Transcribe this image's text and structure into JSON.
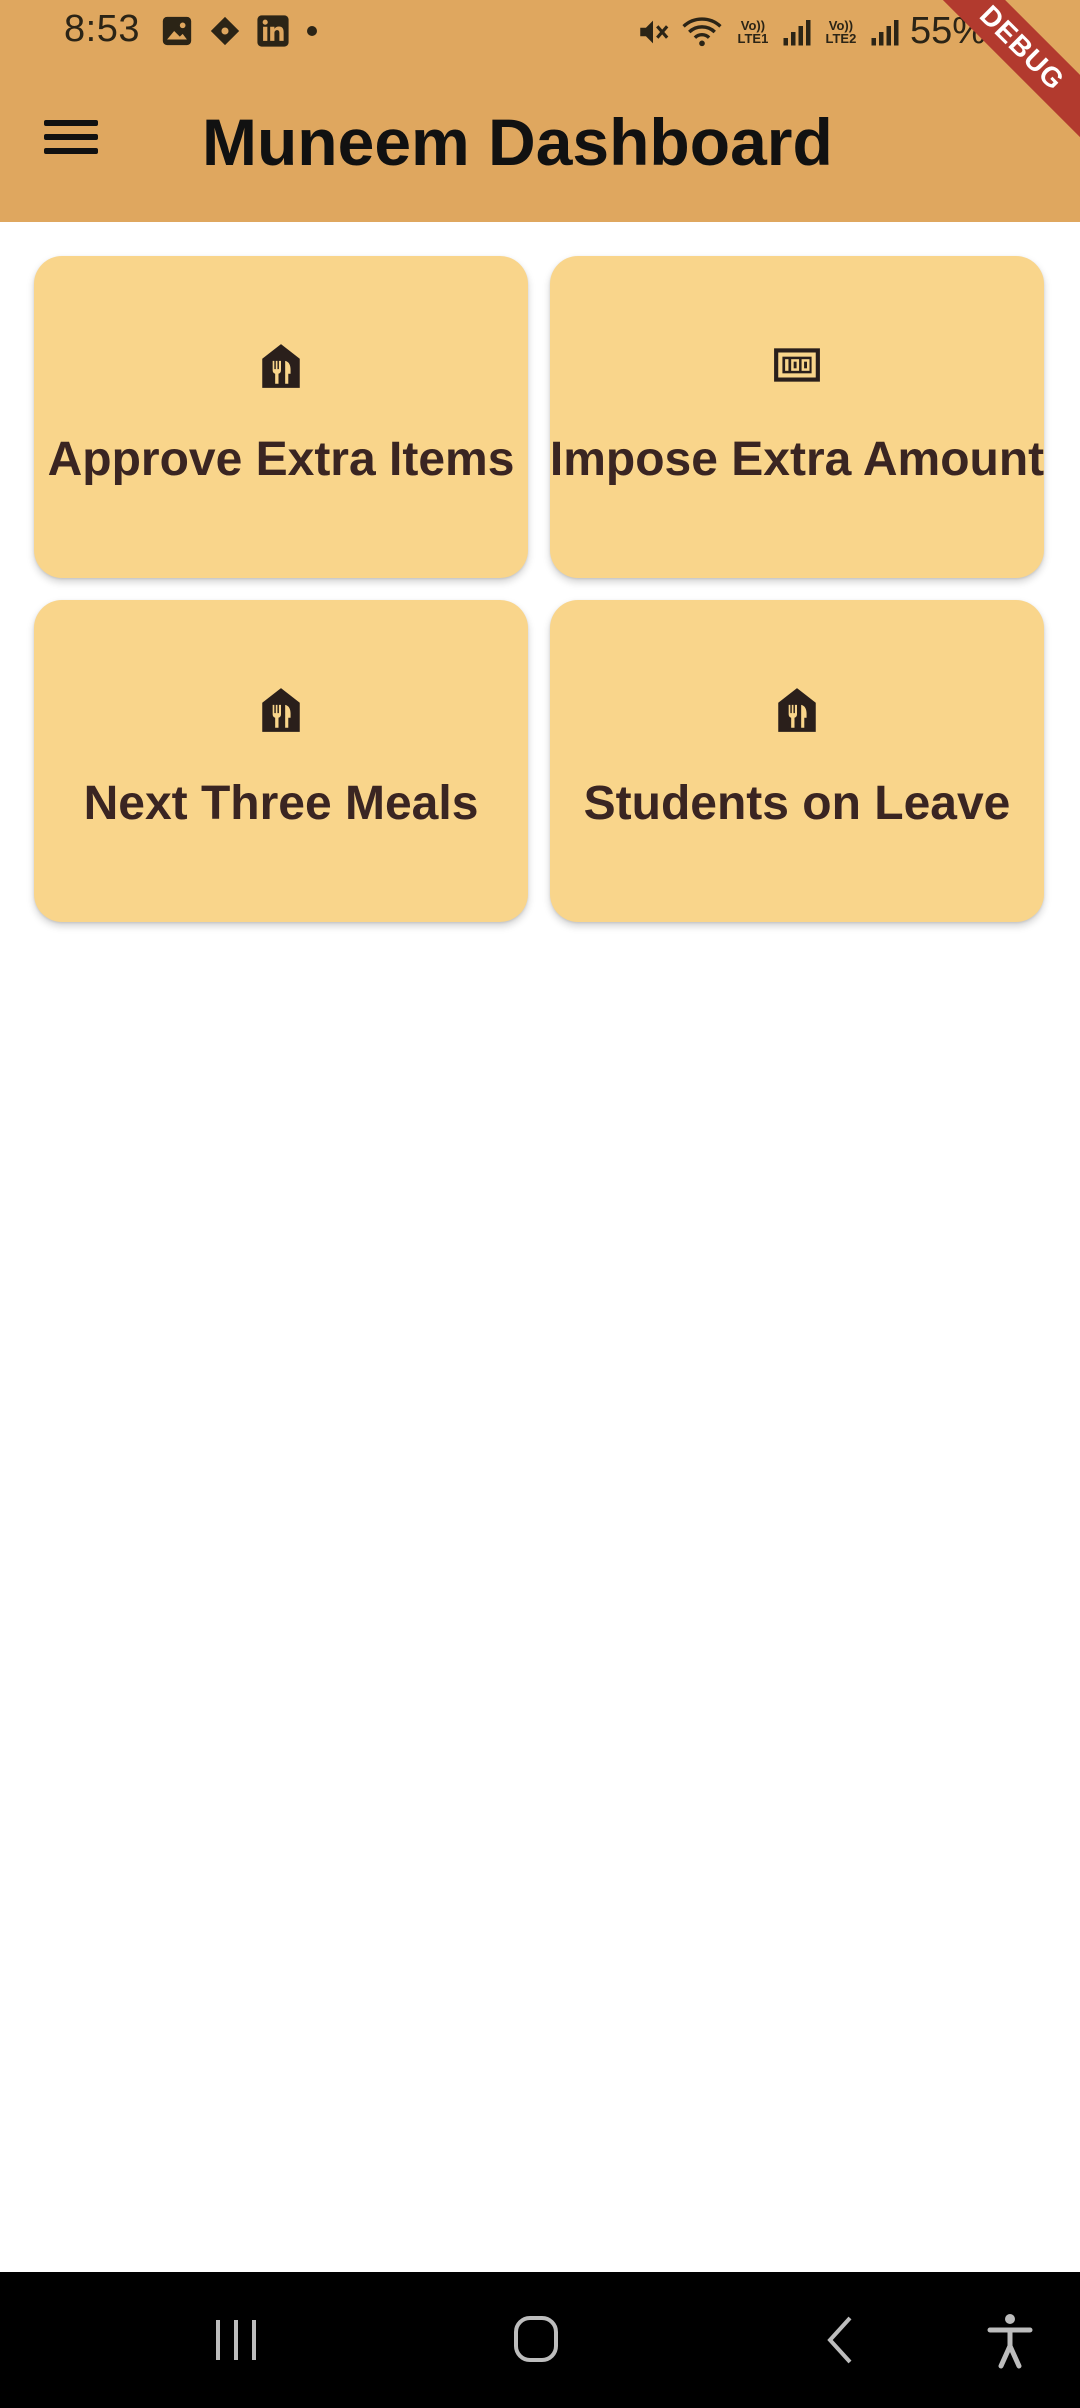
{
  "status_bar": {
    "time": "8:53",
    "left_icons": [
      "gallery-icon",
      "game-icon",
      "linkedin-icon",
      "dot-icon"
    ],
    "sim1_label": "Vo)) LTE1",
    "sim2_label": "Vo)) LTE2",
    "battery": "55%"
  },
  "app_bar": {
    "title": "Muneem Dashboard",
    "menu_icon": "hamburger-menu-icon"
  },
  "debug_banner": "DEBUG",
  "cards": [
    {
      "label": "Approve Extra Items",
      "icon": "restaurant-icon"
    },
    {
      "label": "Impose Extra Amount",
      "icon": "money-icon"
    },
    {
      "label": "Next Three Meals",
      "icon": "restaurant-icon"
    },
    {
      "label": "Students on Leave",
      "icon": "restaurant-icon"
    }
  ],
  "nav_bar": {
    "buttons": [
      "recents-icon",
      "home-icon",
      "back-icon",
      "accessibility-icon"
    ]
  },
  "colors": {
    "app_bar": "#dfa75f",
    "card": "#f9d58b",
    "card_text": "#3a2522",
    "debug": "#b23a2e"
  }
}
